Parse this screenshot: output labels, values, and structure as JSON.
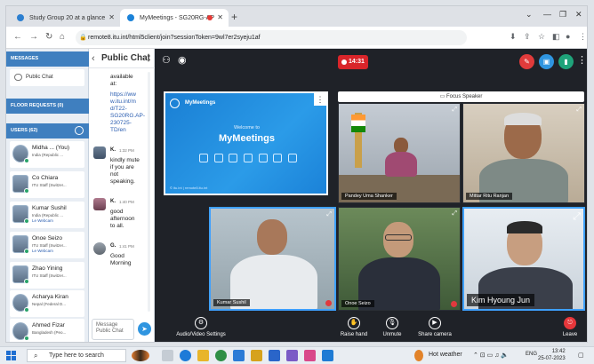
{
  "browser": {
    "tabs": [
      {
        "title": "Study Group 20 at a glance",
        "active": false
      },
      {
        "title": "MyMeetings - SG20RG-AP",
        "active": true
      }
    ],
    "url": "remote8.itu.int/html5client/join?sessionToken=9wl7er2syeju1af"
  },
  "left_panel": {
    "messages_header": "MESSAGES",
    "public_chat_item": "Public Chat",
    "floor_requests_header": "FLOOR REQUESTS (0)",
    "users_header": "USERS (62)",
    "users": [
      {
        "name": "Midha ... (You)",
        "sub": "India (Republic ..."
      },
      {
        "name": "Co Chiara",
        "sub": "ITU Staff (Switzer..."
      },
      {
        "name": "Kumar Sushil",
        "sub": "India (Republic ...",
        "sub2": "Le Webcam"
      },
      {
        "name": "Onoe Seizo",
        "sub": "ITU Staff (Switzer...",
        "sub2": "Le Webcam"
      },
      {
        "name": "Zhao Yining",
        "sub": "ITU Staff (Switzer..."
      },
      {
        "name": "Acharya Kiran",
        "sub": "Nepal (Federal D..."
      },
      {
        "name": "Ahmed Fizar",
        "sub": "Bangladesh (Peo..."
      }
    ]
  },
  "chat": {
    "title": "Public Chat",
    "top_fragment": [
      "available",
      "at:"
    ],
    "link_fragment": [
      "https://ww",
      "w.itu.int/m",
      "d/T22-",
      "SG20RG.AP-",
      "230725-",
      "TD/en"
    ],
    "messages": [
      {
        "author": "K.",
        "time": "1:32 PM",
        "lines": [
          "kindly mute",
          "if you are",
          "not",
          "speaking."
        ]
      },
      {
        "author": "K.",
        "time": "1:40 PM",
        "lines": [
          "good",
          "afternoon",
          "to all."
        ]
      },
      {
        "author": "G.",
        "time": "1:41 PM",
        "lines": [
          "Good",
          "Morning"
        ]
      }
    ],
    "input_placeholder": "Message Public Chat"
  },
  "stage": {
    "timer": "14:31",
    "presentation": {
      "brand": "MyMeetings",
      "welcome": "Welcome to",
      "title": "MyMeetings",
      "footer": "© itu.int | remote8.itu.int"
    },
    "focus_label": "Focus Speaker",
    "participants": [
      {
        "name": "Pandey Uma Shanker"
      },
      {
        "name": "Mittar Ritu Ranjan"
      },
      {
        "name": "Kumar Sushil"
      },
      {
        "name": "Onoe Seizo"
      },
      {
        "name": "Kim Hyoung Jun"
      }
    ],
    "controls": {
      "av_settings": "Audio/Video Settings",
      "raise_hand": "Raise hand",
      "unmute": "Unmute",
      "share_camera": "Share camera",
      "leave": "Leave"
    }
  },
  "taskbar": {
    "search_placeholder": "Type here to search",
    "weather": "Hot weather",
    "lang": "ENG",
    "time": "13:42",
    "date": "25-07-2023"
  },
  "colors": {
    "accent": "#3f7fbf",
    "stage_bg": "#1f2228",
    "rec_red": "#d9252a",
    "send_blue": "#2f95e0"
  }
}
